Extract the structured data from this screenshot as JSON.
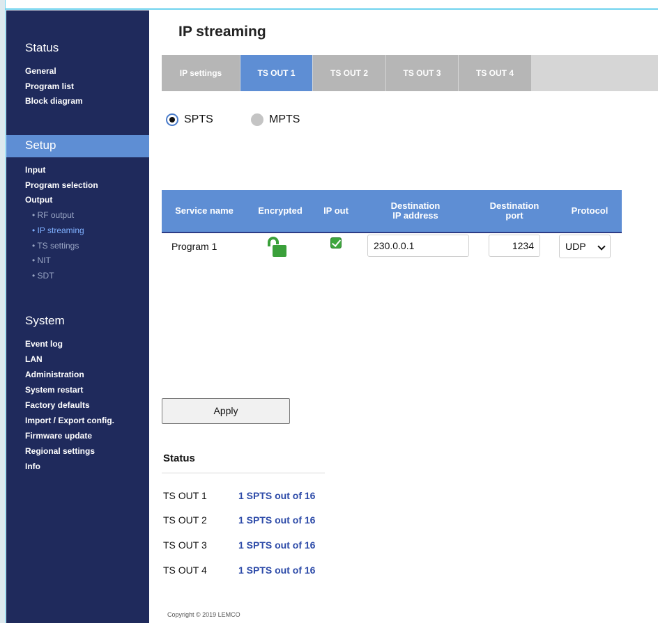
{
  "sidebar": {
    "status_title": "Status",
    "status_links": [
      "General",
      "Program list",
      "Block diagram"
    ],
    "setup_title": "Setup",
    "setup_links": [
      "Input",
      "Program selection",
      "Output"
    ],
    "output_subitems": [
      "RF output",
      "IP streaming",
      "TS settings",
      "NIT",
      "SDT"
    ],
    "system_title": "System",
    "system_links": [
      "Event log",
      "LAN",
      "Administration",
      "System restart",
      "Factory defaults",
      "Import / Export config.",
      "Firmware update",
      "Regional settings",
      "Info"
    ]
  },
  "page": {
    "title": "IP streaming"
  },
  "tabs": [
    "IP settings",
    "TS OUT 1",
    "TS OUT 2",
    "TS OUT 3",
    "TS OUT 4"
  ],
  "active_tab": "TS OUT 1",
  "mode": {
    "options": [
      "SPTS",
      "MPTS"
    ],
    "selected": "SPTS"
  },
  "table": {
    "headers": [
      "Service name",
      "Encrypted",
      "IP out",
      "Destination IP address",
      "Destination port",
      "Protocol"
    ],
    "header_lines": {
      "dest_ip_1": "Destination",
      "dest_ip_2": "IP address",
      "dest_port_1": "Destination",
      "dest_port_2": "port"
    },
    "rows": [
      {
        "service": "Program 1",
        "encrypted": "unlocked",
        "ip_out": true,
        "dest_ip": "230.0.0.1",
        "dest_port": "1234",
        "protocol": "UDP"
      }
    ]
  },
  "apply_label": "Apply",
  "status": {
    "title": "Status",
    "rows": [
      {
        "label": "TS OUT 1",
        "value": "1 SPTS out of 16"
      },
      {
        "label": "TS OUT 2",
        "value": "1 SPTS out of 16"
      },
      {
        "label": "TS OUT 3",
        "value": "1 SPTS out of 16"
      },
      {
        "label": "TS OUT 4",
        "value": "1 SPTS out of 16"
      }
    ]
  },
  "footer": {
    "copyright": "Copyright © 2019 LEMCO"
  },
  "colors": {
    "sidebar": "#1f2a5c",
    "accent": "#5e8ed4",
    "status_value": "#2c4aa8",
    "check_green": "#3da63d",
    "lock_green": "#3aa03a"
  }
}
